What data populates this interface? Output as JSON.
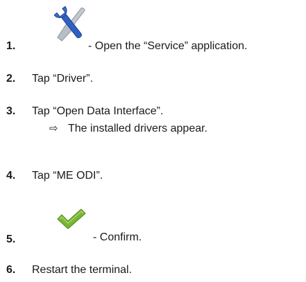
{
  "steps": [
    {
      "number": "1.",
      "icon": "service-tools-icon",
      "text": "- Open the “Service” application."
    },
    {
      "number": "2.",
      "text": "Tap “Driver”."
    },
    {
      "number": "3.",
      "text": "Tap “Open Data Interface”.",
      "result": {
        "symbol": "⇨",
        "text": "The installed drivers appear."
      }
    },
    {
      "number": "4.",
      "text": "Tap “ME ODI”."
    },
    {
      "number": "5.",
      "icon": "confirm-checkmark-icon",
      "text": "- Confirm."
    },
    {
      "number": "6.",
      "text": "Restart the terminal."
    }
  ],
  "colors": {
    "text": "#1a1a1a",
    "wrench_blue": "#2f5fc4",
    "tool_gray": "#b8bec6",
    "check_green": "#78b832"
  }
}
